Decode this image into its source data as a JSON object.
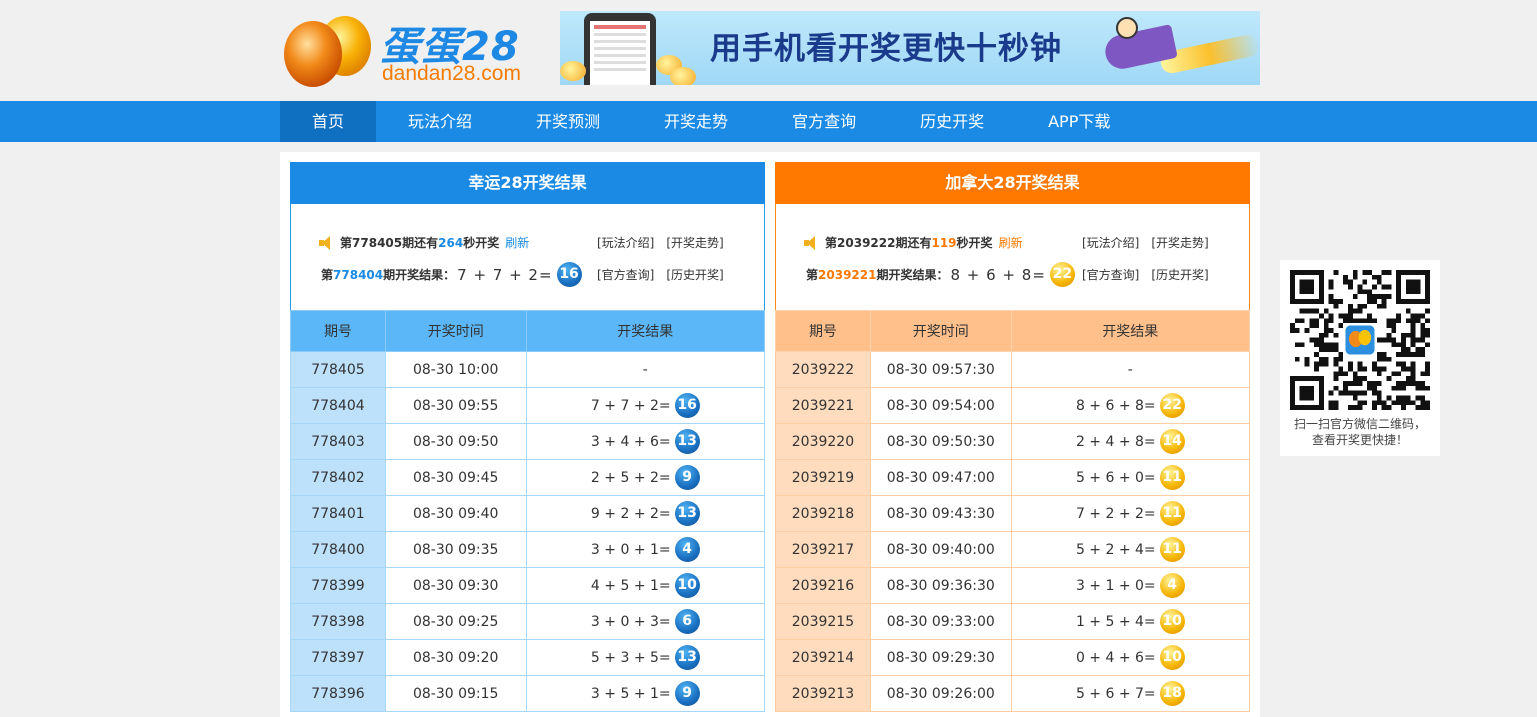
{
  "site": {
    "logo_title": "蛋蛋28",
    "logo_url": "dandan28.com",
    "banner_text": "用手机看开奖更快十秒钟"
  },
  "nav": [
    "首页",
    "玩法介绍",
    "开奖预测",
    "开奖走势",
    "官方查询",
    "历史开奖",
    "APP下载"
  ],
  "lucky": {
    "title": "幸运28开奖结果",
    "countdown_prefix": "第",
    "next_issue": "778405",
    "countdown_mid": "期还有",
    "seconds": "264",
    "countdown_suffix": "秒开奖",
    "refresh": "刷新",
    "last_prefix": "第",
    "last_issue": "778404",
    "last_suffix": "期开奖结果：",
    "last_formula": "7 + 7 + 2=",
    "last_sum": "16",
    "links1": [
      "[玩法介绍]",
      "[开奖走势]"
    ],
    "links2": [
      "[官方查询]",
      "[历史开奖]"
    ],
    "headers": [
      "期号",
      "开奖时间",
      "开奖结果"
    ],
    "rows": [
      {
        "issue": "778405",
        "time": "08-30 10:00",
        "formula": "-",
        "sum": ""
      },
      {
        "issue": "778404",
        "time": "08-30 09:55",
        "formula": "7 + 7 + 2=",
        "sum": "16"
      },
      {
        "issue": "778403",
        "time": "08-30 09:50",
        "formula": "3 + 4 + 6=",
        "sum": "13"
      },
      {
        "issue": "778402",
        "time": "08-30 09:45",
        "formula": "2 + 5 + 2=",
        "sum": "9"
      },
      {
        "issue": "778401",
        "time": "08-30 09:40",
        "formula": "9 + 2 + 2=",
        "sum": "13"
      },
      {
        "issue": "778400",
        "time": "08-30 09:35",
        "formula": "3 + 0 + 1=",
        "sum": "4"
      },
      {
        "issue": "778399",
        "time": "08-30 09:30",
        "formula": "4 + 5 + 1=",
        "sum": "10"
      },
      {
        "issue": "778398",
        "time": "08-30 09:25",
        "formula": "3 + 0 + 3=",
        "sum": "6"
      },
      {
        "issue": "778397",
        "time": "08-30 09:20",
        "formula": "5 + 3 + 5=",
        "sum": "13"
      },
      {
        "issue": "778396",
        "time": "08-30 09:15",
        "formula": "3 + 5 + 1=",
        "sum": "9"
      }
    ]
  },
  "canada": {
    "title": "加拿大28开奖结果",
    "countdown_prefix": "第",
    "next_issue": "2039222",
    "countdown_mid": "期还有",
    "seconds": "119",
    "countdown_suffix": "秒开奖",
    "refresh": "刷新",
    "last_prefix": "第",
    "last_issue": "2039221",
    "last_suffix": "期开奖结果：",
    "last_formula": "8 + 6 + 8=",
    "last_sum": "22",
    "links1": [
      "[玩法介绍]",
      "[开奖走势]"
    ],
    "links2": [
      "[官方查询]",
      "[历史开奖]"
    ],
    "headers": [
      "期号",
      "开奖时间",
      "开奖结果"
    ],
    "rows": [
      {
        "issue": "2039222",
        "time": "08-30 09:57:30",
        "formula": "-",
        "sum": ""
      },
      {
        "issue": "2039221",
        "time": "08-30 09:54:00",
        "formula": "8 + 6 + 8=",
        "sum": "22"
      },
      {
        "issue": "2039220",
        "time": "08-30 09:50:30",
        "formula": "2 + 4 + 8=",
        "sum": "14"
      },
      {
        "issue": "2039219",
        "time": "08-30 09:47:00",
        "formula": "5 + 6 + 0=",
        "sum": "11"
      },
      {
        "issue": "2039218",
        "time": "08-30 09:43:30",
        "formula": "7 + 2 + 2=",
        "sum": "11"
      },
      {
        "issue": "2039217",
        "time": "08-30 09:40:00",
        "formula": "5 + 2 + 4=",
        "sum": "11"
      },
      {
        "issue": "2039216",
        "time": "08-30 09:36:30",
        "formula": "3 + 1 + 0=",
        "sum": "4"
      },
      {
        "issue": "2039215",
        "time": "08-30 09:33:00",
        "formula": "1 + 5 + 4=",
        "sum": "10"
      },
      {
        "issue": "2039214",
        "time": "08-30 09:29:30",
        "formula": "0 + 4 + 6=",
        "sum": "10"
      },
      {
        "issue": "2039213",
        "time": "08-30 09:26:00",
        "formula": "5 + 6 + 7=",
        "sum": "18"
      }
    ]
  },
  "qr": {
    "caption_line1": "扫一扫官方微信二维码，",
    "caption_line2": "查看开奖更快捷！"
  }
}
